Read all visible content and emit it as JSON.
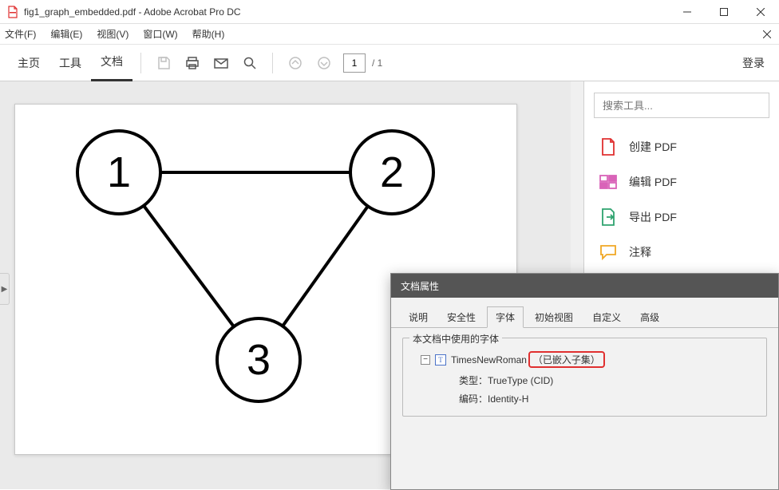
{
  "titlebar": {
    "filename": "fig1_graph_embedded.pdf",
    "app": "Adobe Acrobat Pro DC"
  },
  "menu": {
    "file": "文件(F)",
    "edit": "编辑(E)",
    "view": "视图(V)",
    "window": "窗口(W)",
    "help": "帮助(H)"
  },
  "toolbar": {
    "home": "主页",
    "tools": "工具",
    "document": "文档",
    "page_current": "1",
    "page_total": "/ 1",
    "login": "登录"
  },
  "sidebar": {
    "search_placeholder": "搜索工具...",
    "create_pdf": "创建 PDF",
    "edit_pdf": "编辑 PDF",
    "export_pdf": "导出 PDF",
    "comment": "注释"
  },
  "doc": {
    "node1": "1",
    "node2": "2",
    "node3": "3"
  },
  "dialog": {
    "title": "文档属性",
    "tabs": {
      "desc": "说明",
      "security": "安全性",
      "fonts": "字体",
      "initial_view": "初始视图",
      "custom": "自定义",
      "advanced": "高级"
    },
    "group_label": "本文档中使用的字体",
    "font_name": "TimesNewRoman",
    "font_status": "（已嵌入子集）",
    "type_label": "类型：",
    "type_value": "TrueType (CID)",
    "encoding_label": "编码：",
    "encoding_value": "Identity-H"
  }
}
